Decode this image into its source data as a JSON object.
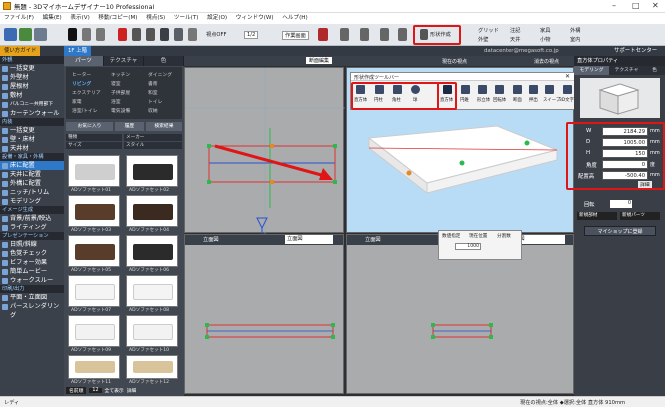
{
  "app": {
    "title": "無題 - 3Dマイホームデザイナー10 Professional"
  },
  "menu": [
    "ファイル(F)",
    "編集(E)",
    "表示(V)",
    "移動/コピー(M)",
    "視点(S)",
    "ツール(T)",
    "設定(O)",
    "ウィンドウ(W)",
    "ヘルプ(H)"
  ],
  "toolbar": {
    "view_level": "視点OFF",
    "scale": "1/2",
    "layout": "作業画面",
    "shape_edit": "形状作成",
    "chk_grid": "グリッド",
    "chk_ceiling": "天井",
    "chk_note": "注記",
    "chk_furniture": "家具",
    "chk_exterior": "外構",
    "chk_wall": "外壁",
    "chk_floor": "床",
    "chk_outdoor": "屋外",
    "chk_small": "小物",
    "chk_room": "室内"
  },
  "darkbar": {
    "guide": "使い方ガイド",
    "floor": "1F 上階",
    "support": "サポートセンター",
    "user": "datacenter@megasoft.co.jp"
  },
  "nav": {
    "sec_exterior": "外観",
    "items_ext": [
      "一括変更",
      "外壁材",
      "屋根材",
      "敷材",
      "バルコニー共用部下",
      "カーテンウォール"
    ],
    "sec_interior": "内装",
    "items_int": [
      "一括変更",
      "壁・床材",
      "天井材"
    ],
    "sec_equip": "設備・家具・外構",
    "items_equip": [
      "床に配置",
      "天井に配置",
      "外構に配置",
      "ニッチ/トリム",
      "モデリング"
    ],
    "sec_image": "イメージ生成",
    "items_image": [
      "背景/前景/映込",
      "ライティング"
    ],
    "sec_present": "プレゼンテーション",
    "items_present": [
      "日照/斜線",
      "色覚チェック",
      "ビフォー効果",
      "簡単ムービー",
      "ウォークスルー"
    ],
    "sec_print": "印刷/出力",
    "items_print": [
      "平面・立面図",
      "パースレンダリング"
    ]
  },
  "parts": {
    "tabs": [
      "パーツ",
      "テクスチャ",
      "色"
    ],
    "categories": [
      "ヒーター",
      "リビング",
      "エクステリア",
      "家電",
      "キッチン",
      "子供部屋",
      "浴室",
      "小物",
      "トイレ",
      "和室",
      "ダイニング",
      "寝室",
      "書斎",
      "電気設備",
      "浴室/トイレ",
      "収納"
    ],
    "fav": "お気に入り",
    "history": "履歴",
    "search": "検索結果",
    "filters": [
      "種類",
      "メーカー",
      "サイズ",
      "スタイル"
    ],
    "items": [
      "ADソファセット01",
      "ADソファセット02",
      "ADソファセット03",
      "ADソファセット04",
      "ADソファセット05",
      "ADソファセット06",
      "ADソファセット07",
      "ADソファセット08",
      "ADソファセット09",
      "ADソファセット10",
      "ADソファセット11",
      "ADソファセット12"
    ],
    "bottom_sort": "名前順",
    "bottom_count": "12",
    "bottom_chk1": "全て表示",
    "bottom_chk2": "詳細"
  },
  "views": {
    "plan_label": "断面編集",
    "front": "立面図",
    "side": "立面図",
    "elev_label": "立",
    "now_pos": "現在の視点",
    "auto_rotate": "消去の視点"
  },
  "shape_toolbar": {
    "title": "形状作成ツールバー",
    "tools": [
      "直方体",
      "円柱",
      "角柱",
      "球",
      "円錐",
      "形立体",
      "回転体",
      "断面",
      "押出",
      "スイープ",
      "3D文字"
    ],
    "opt1": "数値指定",
    "opt2": "現在位置",
    "opt3": "分割数",
    "value": "1000"
  },
  "right": {
    "title": "直方体プロパティ",
    "tab1": "モデリング",
    "tab2": "テクスチャ",
    "tab3": "色",
    "fields": [
      {
        "label": "W",
        "value": "2184.29",
        "unit": "mm"
      },
      {
        "label": "D",
        "value": "1005.00",
        "unit": "mm"
      },
      {
        "label": "H",
        "value": "150",
        "unit": "mm"
      },
      {
        "label": "角度",
        "value": "0",
        "unit": "度"
      },
      {
        "label": "配置高",
        "value": "-500.40",
        "unit": "mm"
      }
    ],
    "detail": "詳細",
    "rotate": "回転",
    "rotate_val": "0",
    "select1": "新規部材",
    "select2": "新規パーツ",
    "guide_btn": "マイショップに登録"
  },
  "status": {
    "left": "レディ",
    "right": "現在の視点:全体 ◆選択:全体 直方体 910mm"
  },
  "colors": {
    "highlight": "#e01515",
    "accent": "#2f78c8",
    "dark": "#3b414a"
  }
}
